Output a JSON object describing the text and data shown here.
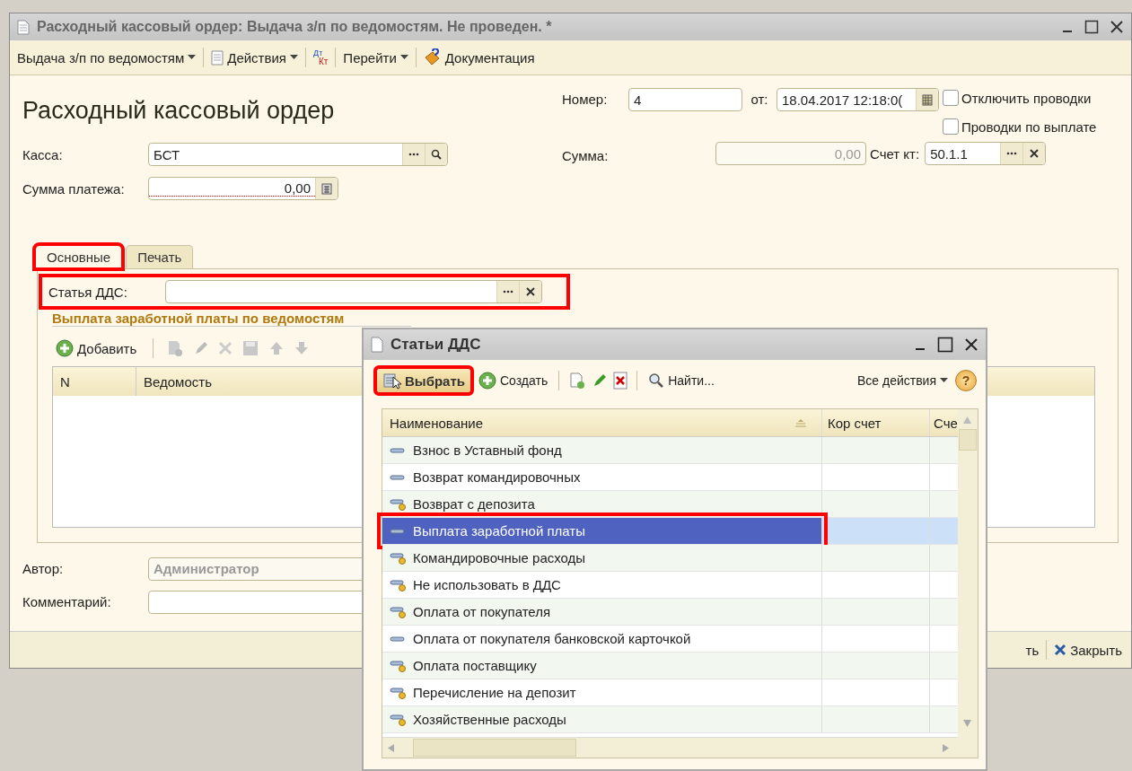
{
  "window": {
    "title": "Расходный кассовый ордер: Выдача з/п по ведомостям. Не проведен. *"
  },
  "toolbar": [
    {
      "kind": "menu",
      "label": "Выдача з/п по ведомостям"
    },
    {
      "kind": "doc-menu",
      "label": "Действия"
    },
    {
      "kind": "dtkt"
    },
    {
      "kind": "menu",
      "label": "Перейти"
    },
    {
      "kind": "book",
      "label": "Документация"
    }
  ],
  "dtkt": {
    "top": "Дт",
    "bottom": "Кт"
  },
  "form": {
    "heading": "Расходный кассовый ордер",
    "kassa": {
      "label": "Касса:",
      "value": "БСТ"
    },
    "payment": {
      "label": "Сумма платежа:",
      "value": "0,00"
    },
    "number": {
      "label": "Номер:",
      "value": "4"
    },
    "date": {
      "label": "от:",
      "value": "18.04.2017 12:18:0("
    },
    "checks": [
      {
        "label": "Отключить проводки",
        "checked": false
      },
      {
        "label": "Проводки по выплате",
        "checked": false
      }
    ],
    "sum": {
      "label": "Сумма:",
      "value": "0,00"
    },
    "account": {
      "label": "Счет кт:",
      "value": "50.1.1"
    }
  },
  "tabs": [
    {
      "label": "Основные",
      "selected": true,
      "highlighted": true
    },
    {
      "label": "Печать",
      "selected": false,
      "highlighted": false
    }
  ],
  "dds": {
    "label": "Статья ДДС:",
    "highlighted": true
  },
  "section": {
    "title": "Выплата заработной платы по ведомостям",
    "add": "Добавить",
    "columns": [
      "N",
      "Ведомость"
    ]
  },
  "author": {
    "label": "Автор:",
    "value": "Администратор"
  },
  "comment": {
    "label": "Комментарий:"
  },
  "bottom_bar": {
    "save_partial": "ть",
    "close": "Закрыть"
  },
  "dialog": {
    "title": "Статьи ДДС",
    "select": {
      "label": "Выбрать",
      "highlighted": true
    },
    "create": "Создать",
    "find": "Найти...",
    "all_actions": "Все действия",
    "help": "?",
    "columns": [
      "Наименование",
      "Кор счет",
      "Сче"
    ],
    "rows": [
      {
        "name": "Взнос в Уставный фонд",
        "kind": "plain",
        "selected": false,
        "highlighted": false
      },
      {
        "name": "Возврат командировочных",
        "kind": "plain",
        "selected": false,
        "highlighted": false
      },
      {
        "name": "Возврат с депозита",
        "kind": "marked",
        "selected": false,
        "highlighted": false
      },
      {
        "name": "Выплата заработной платы",
        "kind": "plain",
        "selected": true,
        "highlighted": true
      },
      {
        "name": "Командировочные расходы",
        "kind": "marked",
        "selected": false,
        "highlighted": false
      },
      {
        "name": "Не использовать в ДДС",
        "kind": "marked",
        "selected": false,
        "highlighted": false
      },
      {
        "name": "Оплата от покупателя",
        "kind": "marked",
        "selected": false,
        "highlighted": false
      },
      {
        "name": "Оплата от покупателя банковской карточкой",
        "kind": "plain",
        "selected": false,
        "highlighted": false
      },
      {
        "name": "Оплата поставщику",
        "kind": "marked",
        "selected": false,
        "highlighted": false
      },
      {
        "name": "Перечисление на депозит",
        "kind": "marked",
        "selected": false,
        "highlighted": false
      },
      {
        "name": "Хозяйственные расходы",
        "kind": "marked",
        "selected": false,
        "highlighted": false
      }
    ]
  }
}
